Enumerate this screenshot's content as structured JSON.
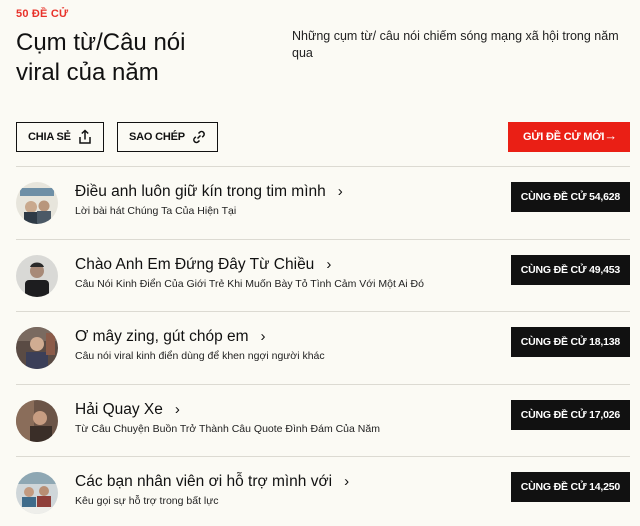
{
  "header": {
    "count_label": "50 ĐỀ CỬ",
    "title": "Cụm từ/Câu nói viral của năm",
    "description": "Những cụm từ/ câu nói chiếm sóng mạng xã hội trong năm qua"
  },
  "actions": {
    "share_label": "CHIA SẺ",
    "copy_label": "SAO CHÉP",
    "submit_label": "GỬI ĐỀ CỬ MỚI",
    "submit_arrow": "→"
  },
  "colors": {
    "accent": "#ea1f15",
    "count_label": "#e8322a",
    "vote_bg": "#111111",
    "background": "#fbfaf4"
  },
  "items": [
    {
      "title": "Điều anh luôn giữ kín trong tim mình",
      "subtitle": "Lời bài hát Chúng Ta Của Hiện Tại",
      "vote_label": "CÙNG ĐỀ CỬ 54,628",
      "avatar_icon": "avatar-image"
    },
    {
      "title": "Chào Anh Em Đứng Đây Từ Chiều",
      "subtitle": "Câu Nói Kinh Điển Của Giới Trẻ Khi Muốn Bày Tỏ Tình Cảm Với Một Ai Đó",
      "vote_label": "CÙNG ĐỀ CỬ 49,453",
      "avatar_icon": "avatar-image"
    },
    {
      "title": "Ơ mây zing, gút chóp em",
      "subtitle": "Câu nói viral kinh điển dùng để khen ngợi người khác",
      "vote_label": "CÙNG ĐỀ CỬ 18,138",
      "avatar_icon": "avatar-image"
    },
    {
      "title": "Hải Quay Xe",
      "subtitle": "Từ Câu Chuyện Buồn Trở Thành Câu Quote Đình Đám Của Năm",
      "vote_label": "CÙNG ĐỀ CỬ 17,026",
      "avatar_icon": "avatar-image"
    },
    {
      "title": "Các bạn nhân viên ơi hỗ trợ mình với",
      "subtitle": "Kêu gọi sự hỗ trợ trong bất lực",
      "vote_label": "CÙNG ĐỀ CỬ 14,250",
      "avatar_icon": "avatar-image"
    }
  ],
  "chevron": "›"
}
